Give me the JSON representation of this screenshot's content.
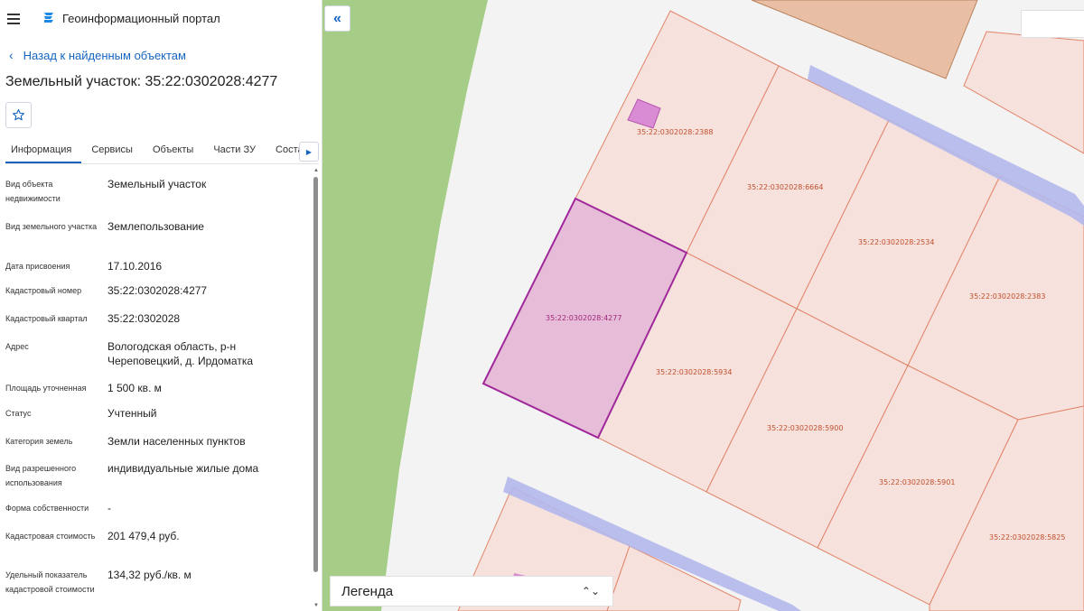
{
  "header": {
    "app_title": "Геоинформационный портал"
  },
  "nav": {
    "back_label": "Назад к найденным объектам"
  },
  "page": {
    "title": "Земельный участок: 35:22:0302028:4277"
  },
  "tabs": [
    {
      "label": "Информация",
      "active": true
    },
    {
      "label": "Сервисы",
      "active": false
    },
    {
      "label": "Объекты",
      "active": false
    },
    {
      "label": "Части ЗУ",
      "active": false
    },
    {
      "label": "Состав",
      "active": false
    }
  ],
  "info": [
    {
      "label": "Вид объекта недвижимости",
      "value": "Земельный участок"
    },
    {
      "label": "Вид земельного участка",
      "value": "Землепользование"
    },
    {
      "label": "Дата присвоения",
      "value": "17.10.2016"
    },
    {
      "label": "Кадастровый номер",
      "value": "35:22:0302028:4277"
    },
    {
      "label": "Кадастровый квартал",
      "value": "35:22:0302028"
    },
    {
      "label": "Адрес",
      "value": "Вологодская область, р-н Череповецкий, д. Ирдоматка"
    },
    {
      "label": "Площадь уточненная",
      "value": "1 500 кв. м"
    },
    {
      "label": "Статус",
      "value": "Учтенный"
    },
    {
      "label": "Категория земель",
      "value": "Земли населенных пунктов"
    },
    {
      "label": "Вид разрешенного использования",
      "value": "индивидуальные жилые дома"
    },
    {
      "label": "Форма собственности",
      "value": "-"
    },
    {
      "label": "Кадастровая стоимость",
      "value": "201 479,4 руб."
    },
    {
      "label": "Удельный показатель кадастровой стоимости",
      "value": "134,32 руб./кв. м"
    }
  ],
  "map": {
    "parcel_labels": [
      "35:22:0302028:2388",
      "35:22:0302028:6664",
      "35:22:0302028:2534",
      "35:22:0302028:2383",
      "35:22:0302028:4277",
      "35:22:0302028:5934",
      "35:22:0302028:5900",
      "35:22:0302028:5901",
      "35:22:0302028:5825"
    ],
    "legend_label": "Легенда"
  },
  "colors": {
    "accent": "#1565c0",
    "parcel_fill": "#f6e1dc",
    "parcel_stroke": "#e2856a",
    "selected_fill": "#e6bcd9",
    "selected_stroke": "#a0289a",
    "green_zone": "#a6cd88",
    "road": "#b3b8ec"
  }
}
